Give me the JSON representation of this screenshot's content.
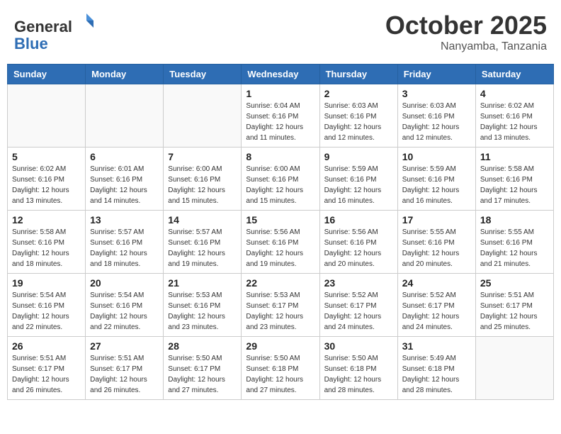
{
  "header": {
    "logo_general": "General",
    "logo_blue": "Blue",
    "month_title": "October 2025",
    "location": "Nanyamba, Tanzania"
  },
  "calendar": {
    "days_of_week": [
      "Sunday",
      "Monday",
      "Tuesday",
      "Wednesday",
      "Thursday",
      "Friday",
      "Saturday"
    ],
    "weeks": [
      [
        {
          "day": "",
          "info": ""
        },
        {
          "day": "",
          "info": ""
        },
        {
          "day": "",
          "info": ""
        },
        {
          "day": "1",
          "info": "Sunrise: 6:04 AM\nSunset: 6:16 PM\nDaylight: 12 hours\nand 11 minutes."
        },
        {
          "day": "2",
          "info": "Sunrise: 6:03 AM\nSunset: 6:16 PM\nDaylight: 12 hours\nand 12 minutes."
        },
        {
          "day": "3",
          "info": "Sunrise: 6:03 AM\nSunset: 6:16 PM\nDaylight: 12 hours\nand 12 minutes."
        },
        {
          "day": "4",
          "info": "Sunrise: 6:02 AM\nSunset: 6:16 PM\nDaylight: 12 hours\nand 13 minutes."
        }
      ],
      [
        {
          "day": "5",
          "info": "Sunrise: 6:02 AM\nSunset: 6:16 PM\nDaylight: 12 hours\nand 13 minutes."
        },
        {
          "day": "6",
          "info": "Sunrise: 6:01 AM\nSunset: 6:16 PM\nDaylight: 12 hours\nand 14 minutes."
        },
        {
          "day": "7",
          "info": "Sunrise: 6:00 AM\nSunset: 6:16 PM\nDaylight: 12 hours\nand 15 minutes."
        },
        {
          "day": "8",
          "info": "Sunrise: 6:00 AM\nSunset: 6:16 PM\nDaylight: 12 hours\nand 15 minutes."
        },
        {
          "day": "9",
          "info": "Sunrise: 5:59 AM\nSunset: 6:16 PM\nDaylight: 12 hours\nand 16 minutes."
        },
        {
          "day": "10",
          "info": "Sunrise: 5:59 AM\nSunset: 6:16 PM\nDaylight: 12 hours\nand 16 minutes."
        },
        {
          "day": "11",
          "info": "Sunrise: 5:58 AM\nSunset: 6:16 PM\nDaylight: 12 hours\nand 17 minutes."
        }
      ],
      [
        {
          "day": "12",
          "info": "Sunrise: 5:58 AM\nSunset: 6:16 PM\nDaylight: 12 hours\nand 18 minutes."
        },
        {
          "day": "13",
          "info": "Sunrise: 5:57 AM\nSunset: 6:16 PM\nDaylight: 12 hours\nand 18 minutes."
        },
        {
          "day": "14",
          "info": "Sunrise: 5:57 AM\nSunset: 6:16 PM\nDaylight: 12 hours\nand 19 minutes."
        },
        {
          "day": "15",
          "info": "Sunrise: 5:56 AM\nSunset: 6:16 PM\nDaylight: 12 hours\nand 19 minutes."
        },
        {
          "day": "16",
          "info": "Sunrise: 5:56 AM\nSunset: 6:16 PM\nDaylight: 12 hours\nand 20 minutes."
        },
        {
          "day": "17",
          "info": "Sunrise: 5:55 AM\nSunset: 6:16 PM\nDaylight: 12 hours\nand 20 minutes."
        },
        {
          "day": "18",
          "info": "Sunrise: 5:55 AM\nSunset: 6:16 PM\nDaylight: 12 hours\nand 21 minutes."
        }
      ],
      [
        {
          "day": "19",
          "info": "Sunrise: 5:54 AM\nSunset: 6:16 PM\nDaylight: 12 hours\nand 22 minutes."
        },
        {
          "day": "20",
          "info": "Sunrise: 5:54 AM\nSunset: 6:16 PM\nDaylight: 12 hours\nand 22 minutes."
        },
        {
          "day": "21",
          "info": "Sunrise: 5:53 AM\nSunset: 6:16 PM\nDaylight: 12 hours\nand 23 minutes."
        },
        {
          "day": "22",
          "info": "Sunrise: 5:53 AM\nSunset: 6:17 PM\nDaylight: 12 hours\nand 23 minutes."
        },
        {
          "day": "23",
          "info": "Sunrise: 5:52 AM\nSunset: 6:17 PM\nDaylight: 12 hours\nand 24 minutes."
        },
        {
          "day": "24",
          "info": "Sunrise: 5:52 AM\nSunset: 6:17 PM\nDaylight: 12 hours\nand 24 minutes."
        },
        {
          "day": "25",
          "info": "Sunrise: 5:51 AM\nSunset: 6:17 PM\nDaylight: 12 hours\nand 25 minutes."
        }
      ],
      [
        {
          "day": "26",
          "info": "Sunrise: 5:51 AM\nSunset: 6:17 PM\nDaylight: 12 hours\nand 26 minutes."
        },
        {
          "day": "27",
          "info": "Sunrise: 5:51 AM\nSunset: 6:17 PM\nDaylight: 12 hours\nand 26 minutes."
        },
        {
          "day": "28",
          "info": "Sunrise: 5:50 AM\nSunset: 6:17 PM\nDaylight: 12 hours\nand 27 minutes."
        },
        {
          "day": "29",
          "info": "Sunrise: 5:50 AM\nSunset: 6:18 PM\nDaylight: 12 hours\nand 27 minutes."
        },
        {
          "day": "30",
          "info": "Sunrise: 5:50 AM\nSunset: 6:18 PM\nDaylight: 12 hours\nand 28 minutes."
        },
        {
          "day": "31",
          "info": "Sunrise: 5:49 AM\nSunset: 6:18 PM\nDaylight: 12 hours\nand 28 minutes."
        },
        {
          "day": "",
          "info": ""
        }
      ]
    ]
  }
}
